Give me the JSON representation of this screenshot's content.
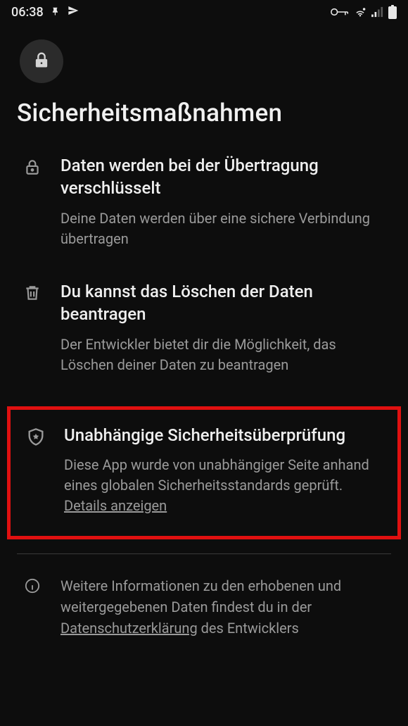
{
  "status": {
    "time": "06:38"
  },
  "header": {
    "title": "Sicherheitsmaßnahmen"
  },
  "items": [
    {
      "title": "Daten werden bei der Übertragung verschlüsselt",
      "desc": "Deine Daten werden über eine sichere Verbindung übertragen"
    },
    {
      "title": "Du kannst das Löschen der Daten beantragen",
      "desc": "Der Entwickler bietet dir die Möglichkeit, das Löschen deiner Daten zu beantragen"
    },
    {
      "title": "Unabhängige Sicherheitsüberprüfung",
      "desc_prefix": "Diese App wurde von unabhängiger Seite anhand eines globalen Sicherheitsstandards geprüft. ",
      "desc_link": "Details anzeigen"
    }
  ],
  "footer": {
    "text_prefix": "Weitere Informationen zu den erhobenen und weitergegebenen Daten findest du in der ",
    "link": "Datenschutzerklärung",
    "text_suffix": " des Entwicklers"
  }
}
